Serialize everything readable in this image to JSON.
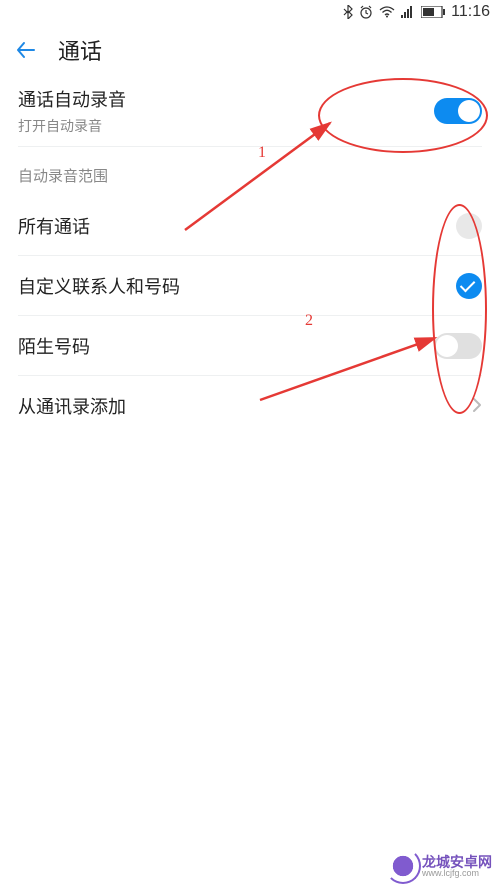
{
  "status": {
    "time": "11:16"
  },
  "header": {
    "title": "通话"
  },
  "auto_record": {
    "title": "通话自动录音",
    "subtitle": "打开自动录音",
    "enabled": true
  },
  "scope": {
    "header": "自动录音范围",
    "items": [
      {
        "label": "所有通话",
        "selected": false
      },
      {
        "label": "自定义联系人和号码",
        "selected": true
      },
      {
        "label": "陌生号码",
        "type": "toggle",
        "enabled": false
      }
    ],
    "add_from_contacts": "从通讯录添加"
  },
  "annotations": {
    "label1": "1",
    "label2": "2"
  },
  "watermark": {
    "main": "龙城安卓网",
    "sub": "www.lcjfg.com"
  }
}
